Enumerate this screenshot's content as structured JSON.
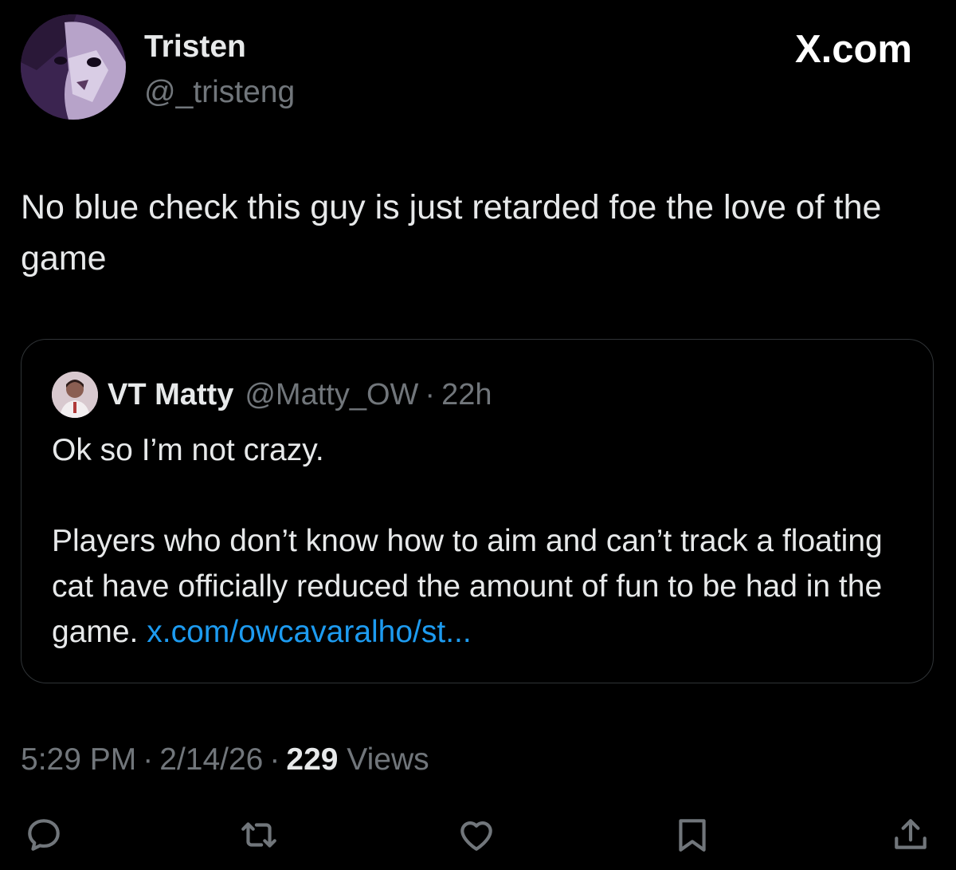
{
  "tweet": {
    "author": {
      "display_name": "Tristen",
      "handle": "@_tristeng"
    },
    "brand": "X.com",
    "text": "No blue check this guy is just retarded foe the love of the game",
    "time": "5:29 PM",
    "date": "2/14/26",
    "views_count": "229",
    "views_label": "Views",
    "separator": "·"
  },
  "quote": {
    "author": {
      "display_name": "VT Matty",
      "handle": "@Matty_OW",
      "time": "22h"
    },
    "paragraph_1": "Ok so I’m not crazy.",
    "paragraph_2": "Players who don’t know how to aim and can’t track a floating cat have officially reduced the amount of fun to be had in the game.",
    "link_text": "x.com/owcavaralho/st..."
  },
  "actions": {
    "icons": [
      "reply-icon",
      "repost-icon",
      "like-icon",
      "bookmark-icon",
      "share-icon"
    ]
  },
  "colors": {
    "background": "#000000",
    "text_primary": "#e7e9ea",
    "text_secondary": "#71767b",
    "link": "#1d9bf0",
    "border": "#2f3336"
  }
}
